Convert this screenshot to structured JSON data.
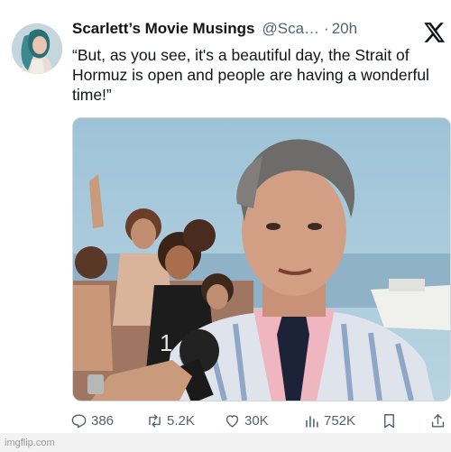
{
  "tweet": {
    "display_name": "Scarlett’s Movie Musings",
    "handle": "@Sca…",
    "separator": "·",
    "time": "20h",
    "text": "“But, as you see, it's a beautiful day, the Strait of Hormuz is open and people are having a wonderful time!”"
  },
  "actions": {
    "replies": "386",
    "reposts": "5.2K",
    "likes": "30K",
    "views": "752K"
  },
  "icons": {
    "platform": "x-logo-icon",
    "reply": "reply-icon",
    "repost": "repost-icon",
    "like": "heart-icon",
    "views": "views-icon",
    "bookmark": "bookmark-icon",
    "share": "share-icon"
  },
  "watermark": "imgflip.com",
  "colors": {
    "text": "#0f1419",
    "secondary": "#536471",
    "background": "#ffffff"
  }
}
